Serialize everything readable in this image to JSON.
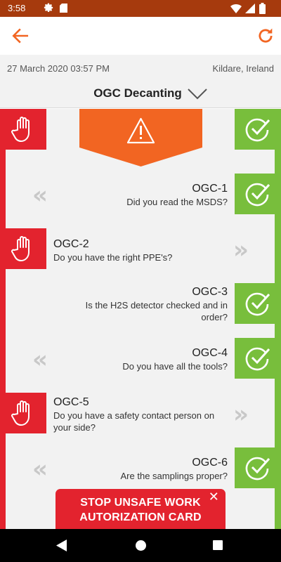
{
  "status_bar": {
    "time": "3:58"
  },
  "info": {
    "date": "27 March 2020 03:57 PM",
    "location": "Kildare, Ireland"
  },
  "title": "OGC Decanting",
  "questions": [
    {
      "code": "OGC-1",
      "text": "Did you read the MSDS?",
      "answer": "yes"
    },
    {
      "code": "OGC-2",
      "text": "Do you have the right PPE's?",
      "answer": "no"
    },
    {
      "code": "OGC-3",
      "text": "Is the H2S detector checked and in order?",
      "answer": "yes"
    },
    {
      "code": "OGC-4",
      "text": "Do you have all the tools?",
      "answer": "yes"
    },
    {
      "code": "OGC-5",
      "text": "Do you have a safety contact person on your side?",
      "answer": "no"
    },
    {
      "code": "OGC-6",
      "text": "Are the samplings proper?",
      "answer": "yes"
    }
  ],
  "swipe_hint_left": "«",
  "swipe_hint_right": "»",
  "stop_card": {
    "line1": "STOP UNSAFE WORK",
    "line2": "AUTORIZATION CARD",
    "close": "✕"
  },
  "colors": {
    "accent": "#f26522",
    "red": "#e3232e",
    "green": "#78be3c",
    "status_bar": "#a63a0d",
    "warning": "#f26522"
  },
  "icons": {
    "back": "arrow-left-icon",
    "refresh": "refresh-icon",
    "dropdown": "chevron-down-icon",
    "warning": "warning-triangle-icon",
    "stop": "stop-hand-icon",
    "check": "check-circle-icon"
  }
}
